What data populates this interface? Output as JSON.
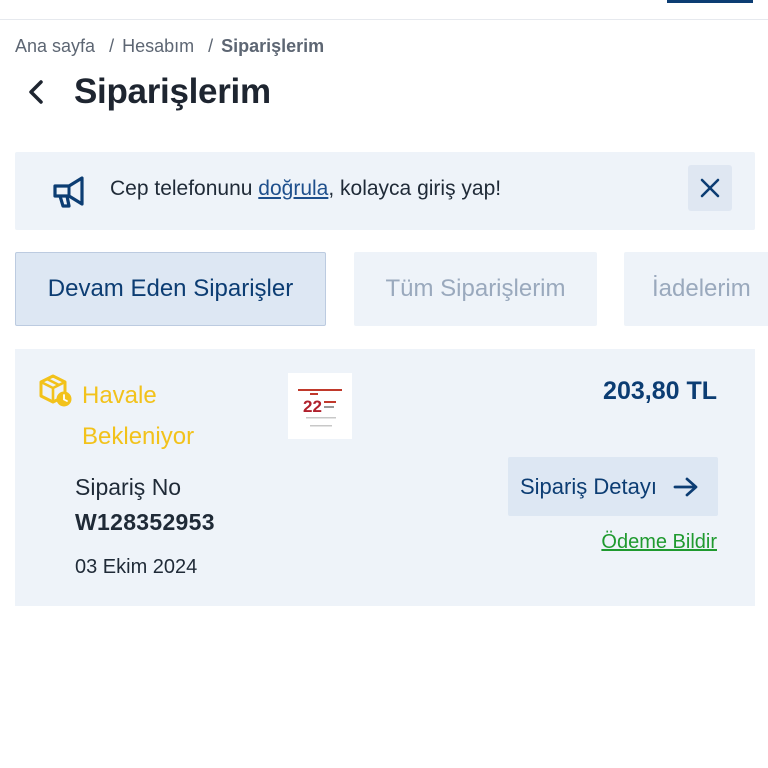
{
  "colors": {
    "primary": "#0c3d73",
    "status_yellow": "#f2c21b",
    "link_green": "#1f9a2f",
    "panel_bg": "#eef3f9"
  },
  "breadcrumb": {
    "items": [
      "Ana sayfa",
      "Hesabım",
      "Siparişlerim"
    ]
  },
  "page": {
    "title": "Siparişlerim",
    "back_icon": "chevron-left-icon"
  },
  "notice": {
    "icon": "megaphone-icon",
    "text_before": "Cep telefonunu ",
    "link_text": "doğrula",
    "text_after": ", kolayca giriş yap!",
    "close_icon": "close-icon"
  },
  "tabs": [
    {
      "label": "Devam Eden Siparişler",
      "active": true
    },
    {
      "label": "Tüm Siparişlerim",
      "active": false
    },
    {
      "label": "İadelerim",
      "active": false
    }
  ],
  "order": {
    "status_icon": "package-clock-icon",
    "status_line1": "Havale",
    "status_line2": "Bekleniyor",
    "price": "203,80 TL",
    "order_no_label": "Sipariş No",
    "order_no": "W128352953",
    "date": "03 Ekim 2024",
    "detail_button": "Sipariş Detayı",
    "detail_icon": "arrow-right-icon",
    "notify_link": "Ödeme Bildir",
    "thumbnail_number": "22"
  }
}
